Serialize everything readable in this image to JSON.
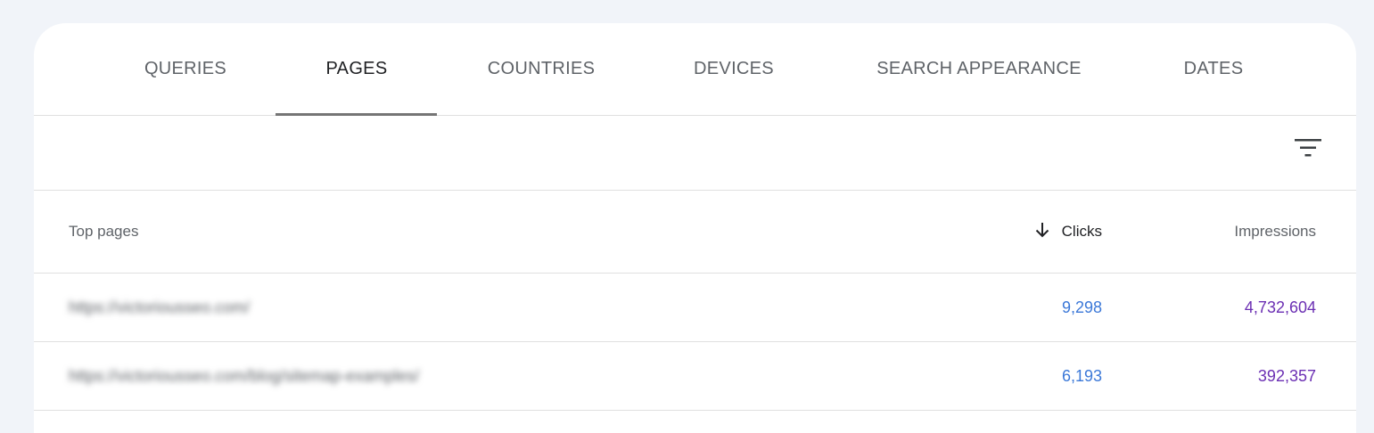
{
  "tabs": [
    {
      "label": "QUERIES",
      "active": false
    },
    {
      "label": "PAGES",
      "active": true
    },
    {
      "label": "COUNTRIES",
      "active": false
    },
    {
      "label": "DEVICES",
      "active": false
    },
    {
      "label": "SEARCH APPEARANCE",
      "active": false
    },
    {
      "label": "DATES",
      "active": false
    }
  ],
  "toolbar": {
    "filter_icon": "filter-list-icon"
  },
  "table": {
    "headers": {
      "page": "Top pages",
      "clicks": "Clicks",
      "impressions": "Impressions",
      "sort_icon": "arrow-downward-icon"
    },
    "rows": [
      {
        "url": "https://victoriousseo.com/",
        "clicks": "9,298",
        "impressions": "4,732,604"
      },
      {
        "url": "https://victoriousseo.com/blog/sitemap-examples/",
        "clicks": "6,193",
        "impressions": "392,357"
      }
    ]
  },
  "colors": {
    "clicks": "#3b78d8",
    "impressions": "#6b2fb3",
    "background": "#f1f4f9"
  }
}
